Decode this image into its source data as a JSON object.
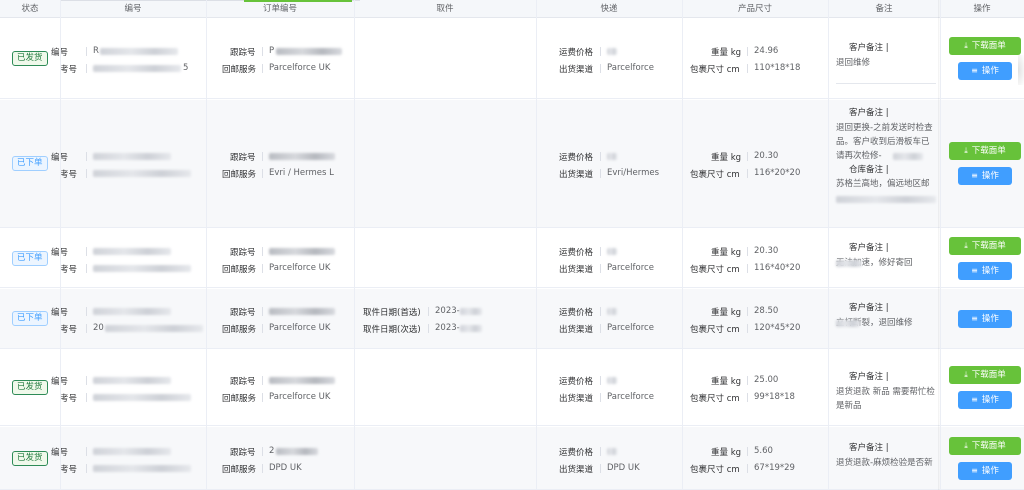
{
  "columns": [
    "状态",
    "编号",
    "订单编号",
    "取件",
    "快递",
    "产品尺寸",
    "备注",
    "操作"
  ],
  "labels": {
    "tracking": "跟踪号",
    "return_service": "回邮服务",
    "shipping_price": "运费价格",
    "channel": "出货渠道",
    "weight": "重量 kg",
    "size": "包裹尺寸 cm",
    "customer_note": "客户备注",
    "warehouse_note": "仓库备注",
    "pickup_first": "取件日期(首选)",
    "pickup_second": "取件日期(次选)",
    "id_label": "编号",
    "ref_label": "考号"
  },
  "buttons": {
    "download": "下载面单",
    "action": "操作"
  },
  "rows": [
    {
      "status": "已发货",
      "status_type": "shipped",
      "id_prefix": "R",
      "ref_suffix": "5",
      "tracking_prefix": "P",
      "return_service": "Parcelforce UK",
      "channel": "Parcelforce",
      "weight": "24.96",
      "size": "110*18*18",
      "note_lines": [
        "退回维修"
      ],
      "has_download": true
    },
    {
      "status": "已下单",
      "status_type": "ordered",
      "return_service": "Evri / Hermes L",
      "channel": "Evri/Hermes",
      "weight": "20.30",
      "size": "116*20*20",
      "note_lines": [
        "退回更换-之前发送时检查",
        "品。客户收到后滑板车已",
        "请再次检修-"
      ],
      "warehouse_note": "苏格兰高地，偏远地区邮",
      "has_download": true
    },
    {
      "status": "已下单",
      "status_type": "ordered",
      "return_service": "Parcelforce UK",
      "channel": "Parcelforce",
      "weight": "20.30",
      "size": "116*40*20",
      "note_lines": [
        "无法加速，修好寄回"
      ],
      "has_download": true
    },
    {
      "status": "已下单",
      "status_type": "ordered",
      "id_prefix": "",
      "ref_prefix": "20",
      "return_service": "Parcelforce UK",
      "pickup_first": "2023-",
      "pickup_second": "2023-",
      "channel": "Parcelforce",
      "weight": "28.50",
      "size": "120*45*20",
      "note_lines": [
        "立杆断裂，退回维修"
      ],
      "has_download": false
    },
    {
      "status": "已发货",
      "status_type": "shipped",
      "return_service": "Parcelforce UK",
      "channel": "Parcelforce",
      "weight": "25.00",
      "size": "99*18*18",
      "note_lines": [
        "退货退款 新品 需要帮忙检",
        "是新品"
      ],
      "has_download": true
    },
    {
      "status": "已发货",
      "status_type": "shipped",
      "tracking_prefix": "2",
      "return_service": "DPD UK",
      "channel": "DPD UK",
      "weight": "5.60",
      "size": "67*19*29",
      "note_lines": [
        "退货退款-麻烦检验是否新"
      ],
      "has_download": true
    }
  ]
}
